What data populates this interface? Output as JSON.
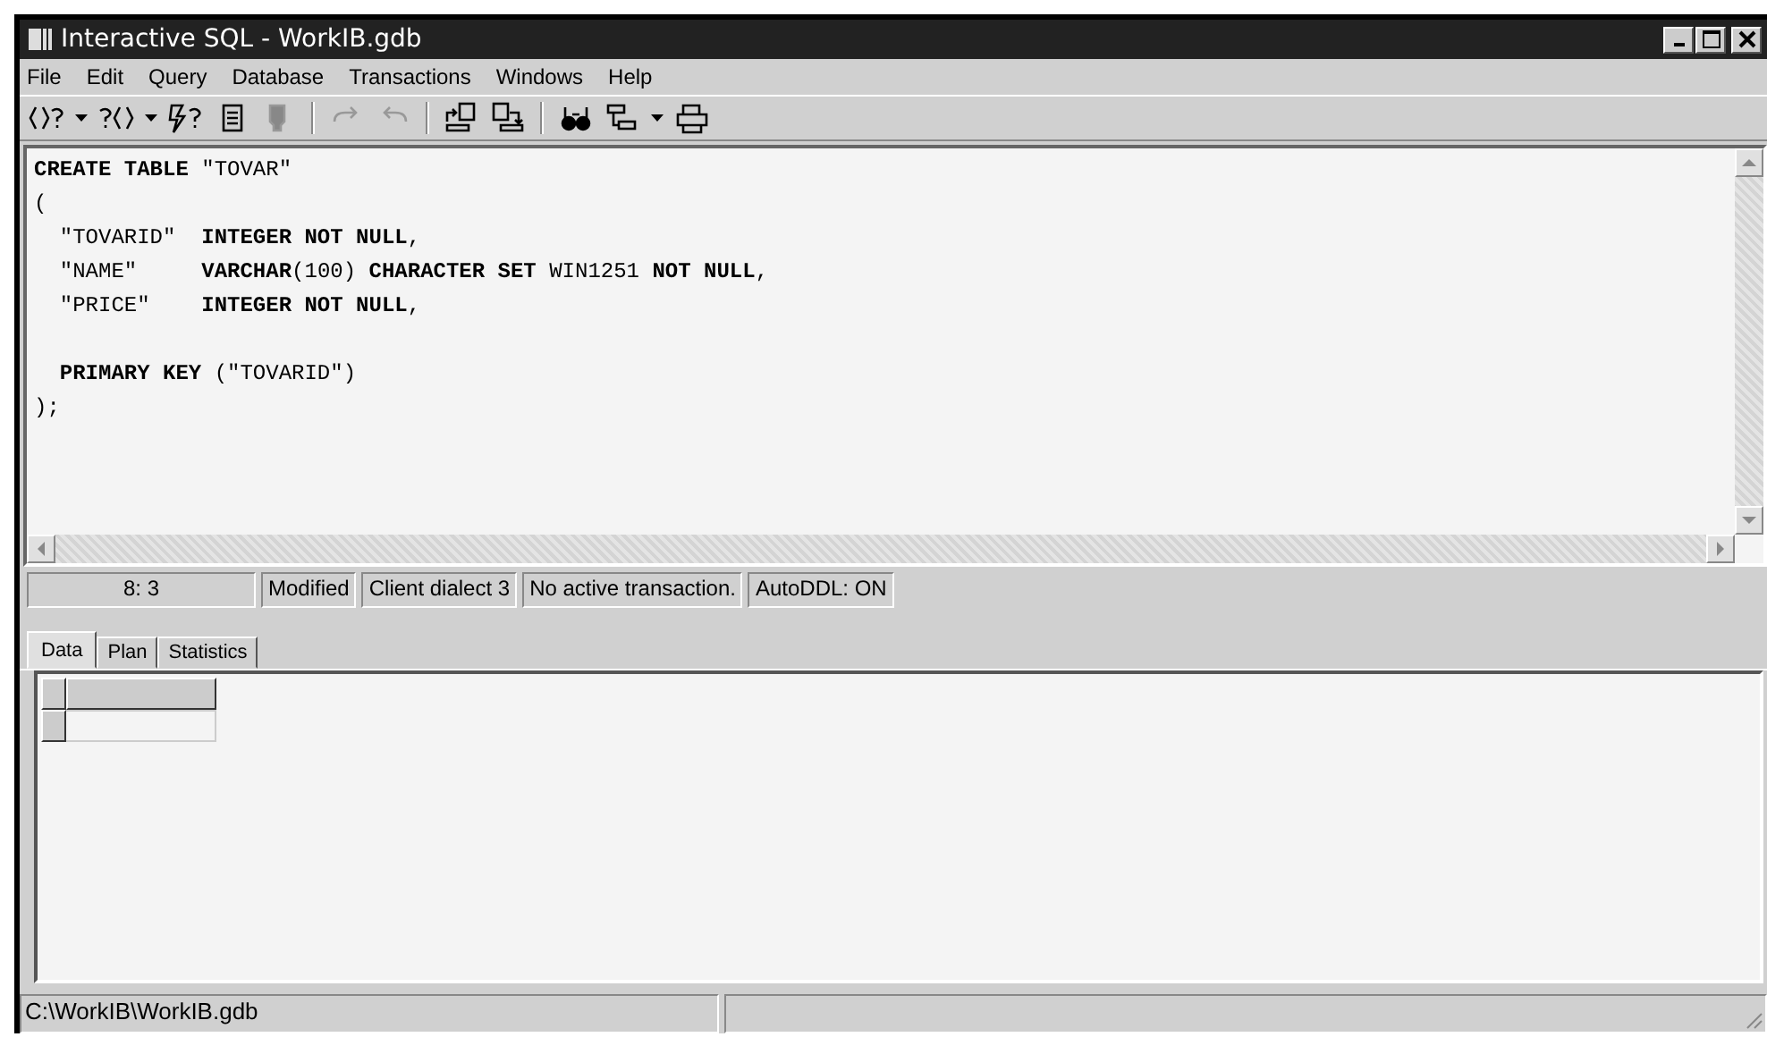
{
  "window": {
    "title": "Interactive SQL - WorkIB.gdb"
  },
  "menu": [
    "File",
    "Edit",
    "Query",
    "Database",
    "Transactions",
    "Windows",
    "Help"
  ],
  "toolbar": [
    {
      "kind": "prev-query",
      "disabled": false
    },
    {
      "kind": "dropdown",
      "disabled": false
    },
    {
      "kind": "next-query",
      "disabled": false
    },
    {
      "kind": "dropdown",
      "disabled": false
    },
    {
      "kind": "execute",
      "disabled": false
    },
    {
      "kind": "notepad",
      "disabled": false
    },
    {
      "kind": "stamp",
      "disabled": true
    },
    {
      "kind": "separator",
      "disabled": false
    },
    {
      "kind": "redo",
      "disabled": true
    },
    {
      "kind": "undo",
      "disabled": true
    },
    {
      "kind": "separator",
      "disabled": false
    },
    {
      "kind": "load",
      "disabled": false
    },
    {
      "kind": "save",
      "disabled": false
    },
    {
      "kind": "separator",
      "disabled": false
    },
    {
      "kind": "find",
      "disabled": false
    },
    {
      "kind": "tree",
      "disabled": false
    },
    {
      "kind": "dropdown",
      "disabled": false
    },
    {
      "kind": "print",
      "disabled": false
    }
  ],
  "editor": {
    "blocks": [
      {
        "lines": [
          "**CREATE TABLE** \"TOVAR\"",
          "(",
          "  \"TOVARID\"  **INTEGER NOT NULL**,",
          "  \"NAME\"     **VARCHAR**(100) **CHARACTER SET** WIN1251 **NOT NULL**,",
          "  \"PRICE\"    **INTEGER NOT NULL**,"
        ]
      },
      {
        "lines": [
          "  **PRIMARY KEY** (\"TOVARID\")",
          ");"
        ]
      }
    ]
  },
  "editor_status": [
    "8:  3",
    "Modified",
    "Client dialect 3",
    "No active transaction.",
    "AutoDDL: ON"
  ],
  "tabs": [
    {
      "label": "Data",
      "selected": true
    },
    {
      "label": "Plan",
      "selected": false
    },
    {
      "label": "Statistics",
      "selected": false
    }
  ],
  "grid": {
    "rows": [
      {
        "kind": "header"
      },
      {
        "kind": "row"
      }
    ]
  },
  "status_bar": {
    "path": "C:\\WorkIB\\WorkIB.gdb"
  }
}
